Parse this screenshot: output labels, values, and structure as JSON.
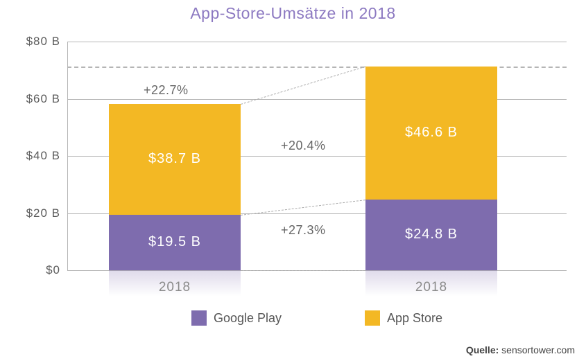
{
  "chart_data": {
    "type": "bar",
    "stacked": true,
    "title": "App-Store-Umsätze in 2018",
    "categories": [
      "2018",
      "2018"
    ],
    "series": [
      {
        "name": "Google Play",
        "color": "#7e6cae",
        "values": [
          19.5,
          24.8
        ],
        "labels": [
          "$19.5 B",
          "$24.8 B"
        ]
      },
      {
        "name": "App Store",
        "color": "#f3b824",
        "values": [
          38.7,
          46.6
        ],
        "labels": [
          "$38.7 B",
          "$46.6 B"
        ]
      }
    ],
    "totals": [
      58.2,
      71.4
    ],
    "growth": {
      "google_play": "+27.3%",
      "app_store": "+20.4%",
      "total": "+22.7%"
    },
    "y_ticks": [
      0,
      20,
      40,
      60,
      80
    ],
    "y_tick_labels": [
      "$0",
      "$20 B",
      "$40 B",
      "$60 B",
      "$80 B"
    ],
    "ylim": [
      0,
      80
    ],
    "reference_line": 71.4
  },
  "legend": {
    "google_play": "Google Play",
    "app_store": "App Store"
  },
  "source": {
    "prefix": "Quelle: ",
    "text": "sensortower.com"
  }
}
